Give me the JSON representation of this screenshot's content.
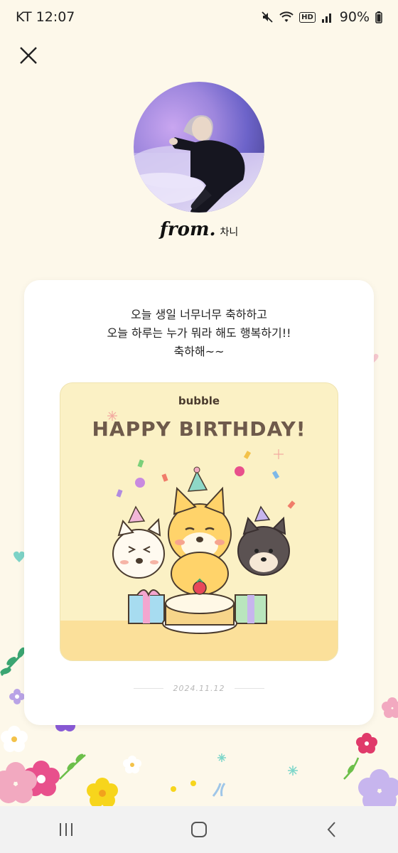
{
  "status_bar": {
    "carrier_time": "KT 12:07",
    "hd_label": "HD",
    "battery": "90%"
  },
  "header": {
    "from_label": "from.",
    "sender_name": "차니"
  },
  "message": {
    "lines": [
      "오늘 생일 너무너무 축하하고",
      "오늘 하루는 누가 뭐라 해도 행복하기!!",
      "축하해~~"
    ]
  },
  "card_image": {
    "brand": "bubble",
    "title": "HAPPY BIRTHDAY!"
  },
  "date": "2024.11.12",
  "colors": {
    "background": "#fdf8ea",
    "card": "#ffffff",
    "birthday_bg": "#fbf1c5",
    "title": "#6e5a4b"
  },
  "icons": [
    "close-icon",
    "mute-icon",
    "wifi-icon",
    "signal-icon",
    "battery-icon",
    "recent-apps-icon",
    "home-icon",
    "back-icon"
  ]
}
